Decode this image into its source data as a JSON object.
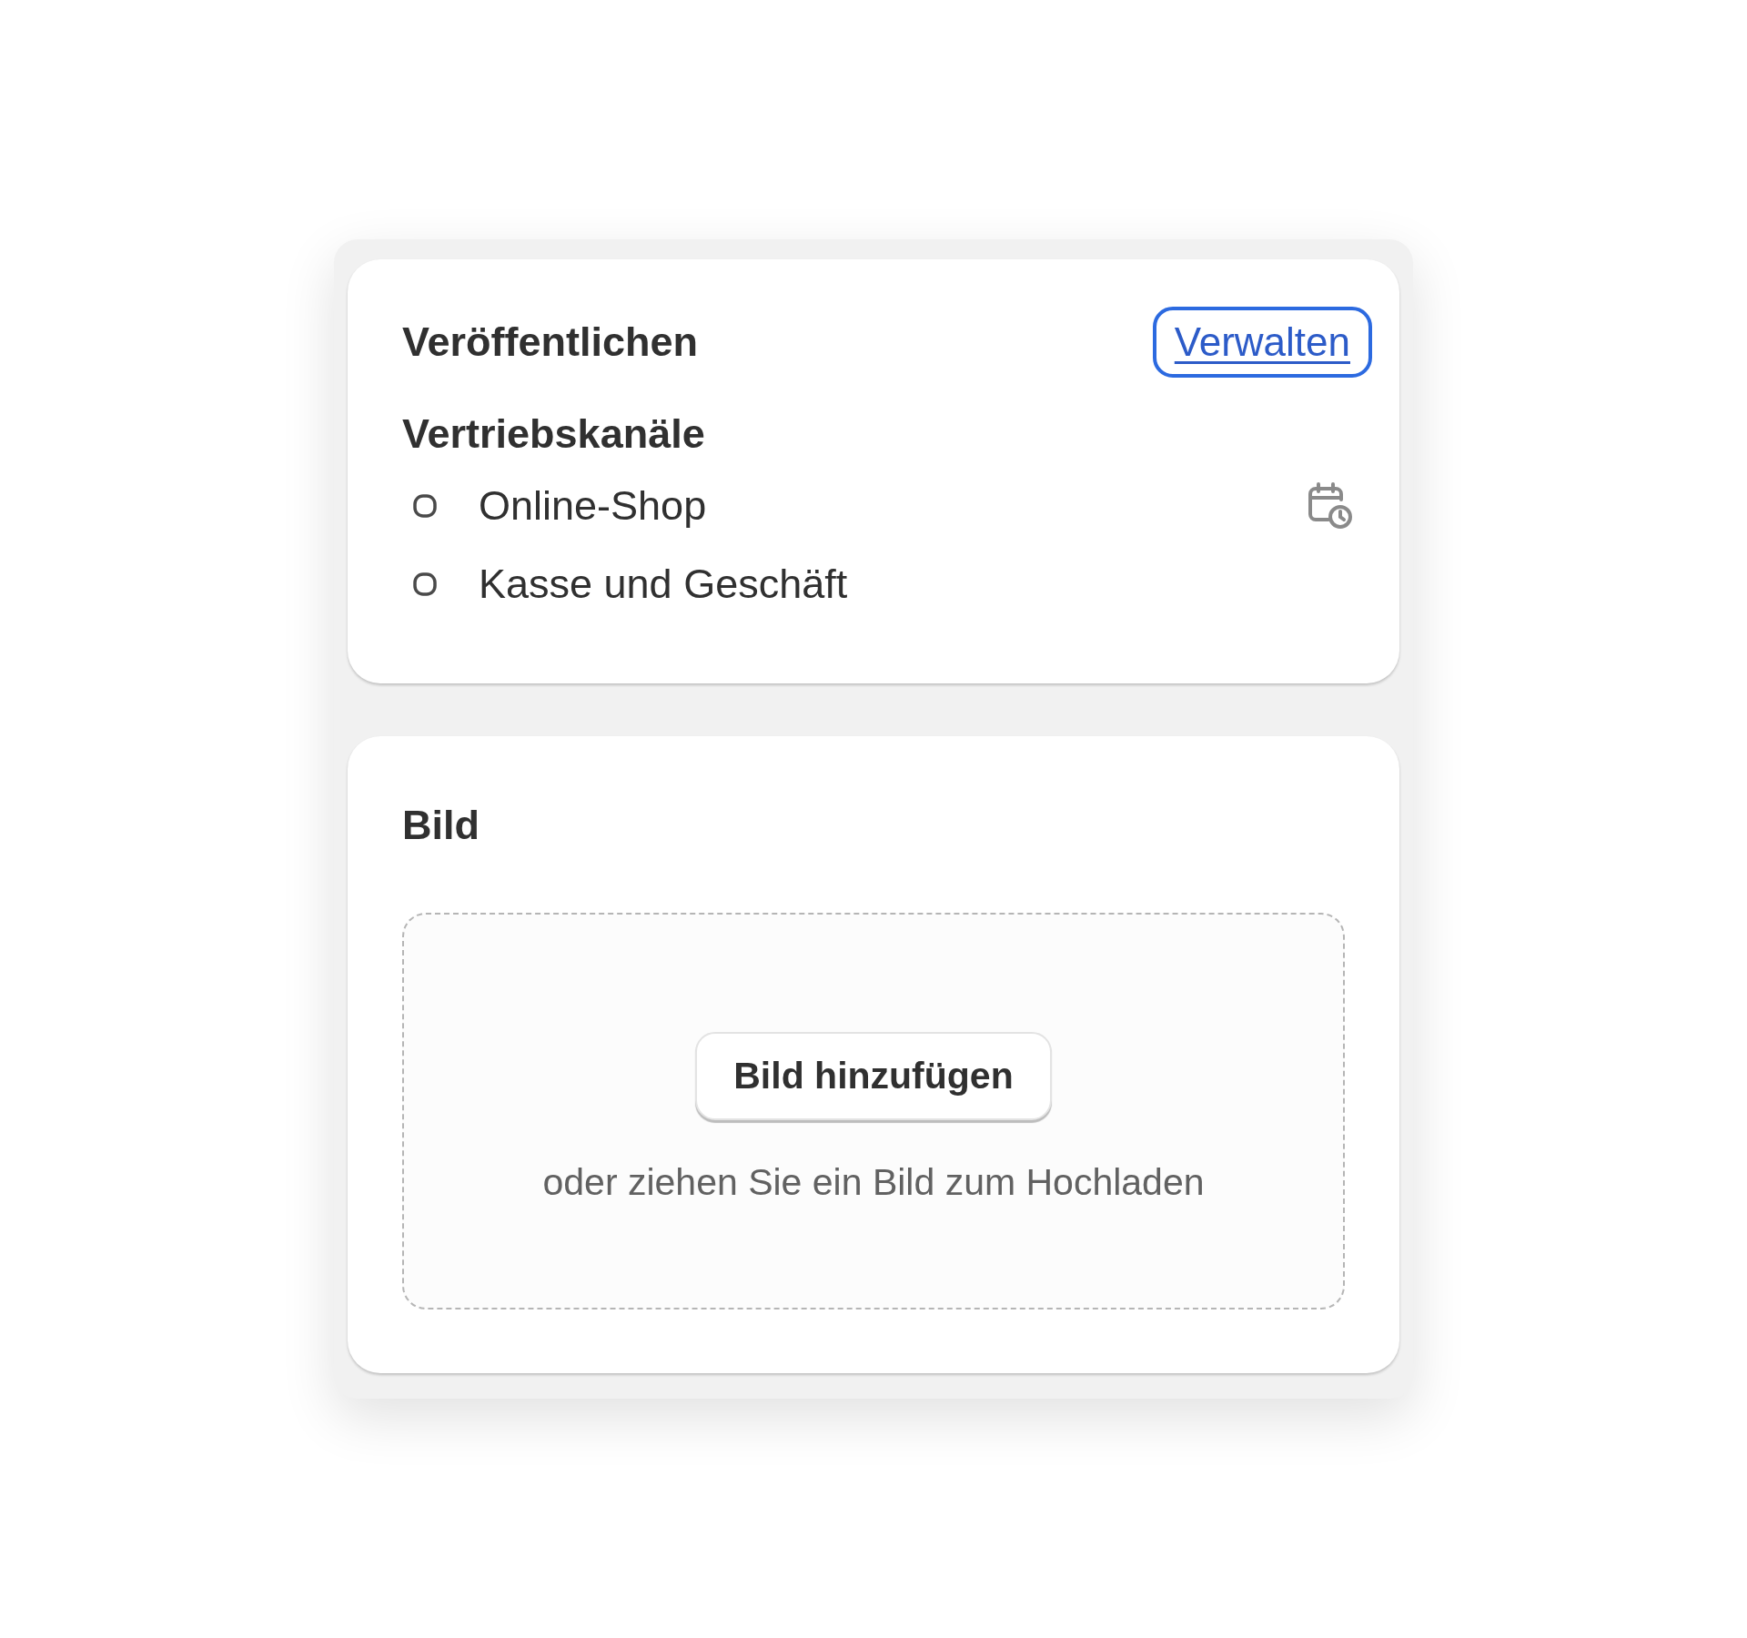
{
  "publish_card": {
    "title": "Veröffentlichen",
    "manage_link": "Verwalten",
    "section_title": "Vertriebskanäle",
    "channels": [
      {
        "name": "Online-Shop",
        "scheduled": true
      },
      {
        "name": "Kasse und Geschäft",
        "scheduled": false
      }
    ]
  },
  "image_card": {
    "title": "Bild",
    "add_button": "Bild hinzufügen",
    "hint": "oder ziehen Sie ein Bild zum Hochladen"
  }
}
